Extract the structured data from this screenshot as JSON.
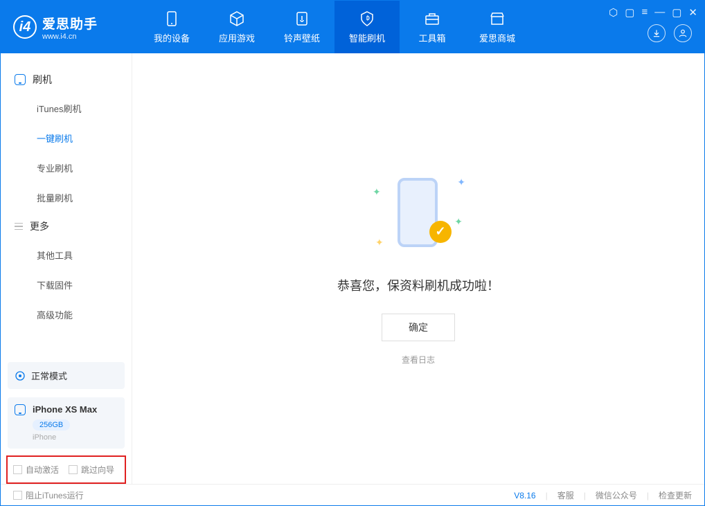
{
  "app": {
    "title": "爱思助手",
    "url": "www.i4.cn"
  },
  "nav": {
    "tabs": [
      {
        "label": "我的设备"
      },
      {
        "label": "应用游戏"
      },
      {
        "label": "铃声壁纸"
      },
      {
        "label": "智能刷机"
      },
      {
        "label": "工具箱"
      },
      {
        "label": "爱思商城"
      }
    ]
  },
  "sidebar": {
    "group1": {
      "title": "刷机",
      "items": [
        "iTunes刷机",
        "一键刷机",
        "专业刷机",
        "批量刷机"
      ]
    },
    "group2": {
      "title": "更多",
      "items": [
        "其他工具",
        "下载固件",
        "高级功能"
      ]
    },
    "mode": "正常模式",
    "device": {
      "name": "iPhone XS Max",
      "capacity": "256GB",
      "type": "iPhone"
    },
    "opt_auto": "自动激活",
    "opt_skip": "跳过向导"
  },
  "main": {
    "success_msg": "恭喜您，保资料刷机成功啦！",
    "ok": "确定",
    "view_log": "查看日志"
  },
  "footer": {
    "block_itunes": "阻止iTunes运行",
    "version": "V8.16",
    "service": "客服",
    "wechat": "微信公众号",
    "update": "检查更新"
  }
}
